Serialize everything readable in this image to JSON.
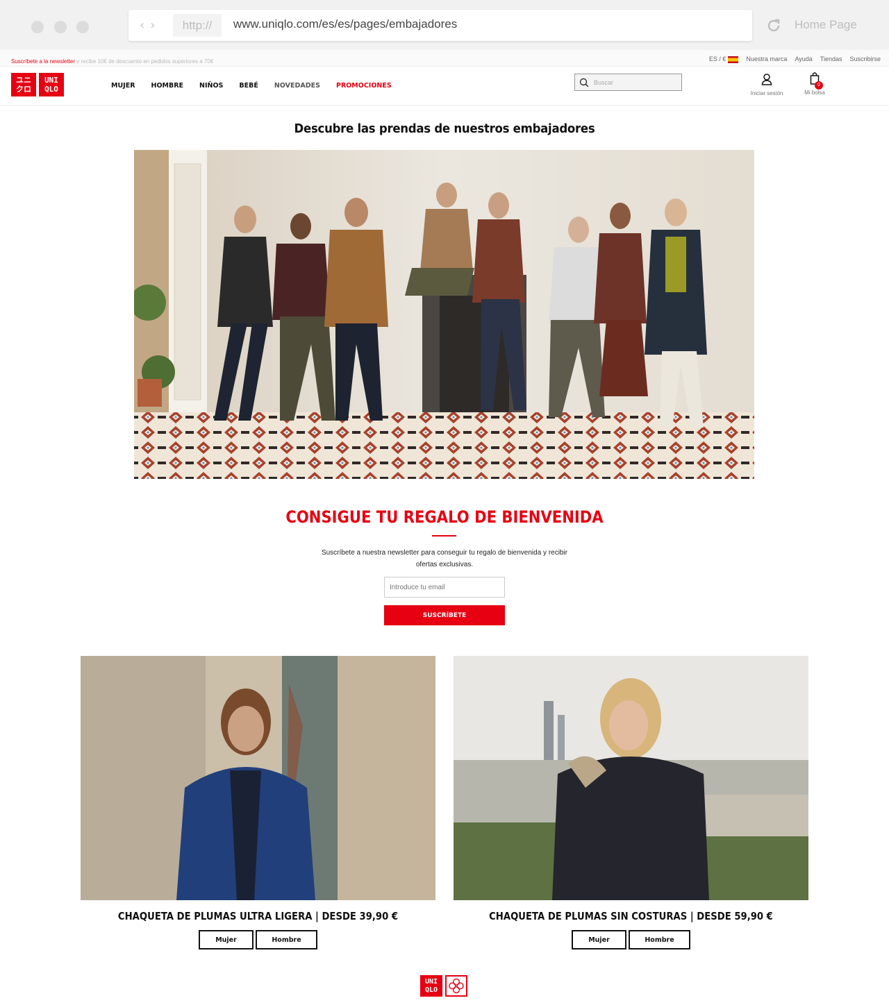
{
  "browser": {
    "protocol": "http://",
    "url": "www.uniqlo.com/es/es/pages/embajadores",
    "home_label": "Home Page"
  },
  "utility": {
    "promo_red": "Suscríbete a la newsletter",
    "promo_grey": " y recibe 10€ de descuento en pedidos superiores a 70€",
    "locale": "ES / €",
    "links": [
      "Nuestra marca",
      "Ayuda",
      "Tiendas",
      "Suscribirse"
    ]
  },
  "header": {
    "logo_top_left": "ユニ",
    "logo_bottom_left": "クロ",
    "logo_top_right": "UNI",
    "logo_bottom_right": "QLO",
    "nav": [
      "MUJER",
      "HOMBRE",
      "NIÑOS",
      "BEBÉ",
      "NOVEDADES",
      "PROMOCIONES"
    ],
    "search_placeholder": "Buscar",
    "account_label": "Iniciar sesión",
    "bag_label": "Mi bolsa",
    "bag_count": "0"
  },
  "hero": {
    "title": "Descubre las prendas de nuestros embajadores"
  },
  "newsletter": {
    "title": "CONSIGUE TU REGALO DE BIENVENIDA",
    "text": "Suscríbete a nuestra newsletter para conseguir tu regalo de bienvenida y recibir ofertas exclusivas.",
    "email_placeholder": "Introduce tu email",
    "button": "SUSCRÍBETE"
  },
  "products": [
    {
      "title": "CHAQUETA DE PLUMAS ULTRA LIGERA | DESDE 39,90 €",
      "btn_women": "Mujer",
      "btn_men": "Hombre"
    },
    {
      "title": "CHAQUETA DE PLUMAS SIN COSTURAS | DESDE 59,90 €",
      "btn_women": "Mujer",
      "btn_men": "Hombre"
    }
  ],
  "footer": {
    "logo_top": "UNI",
    "logo_bottom": "QLO"
  },
  "colors": {
    "brand_red": "#e60012",
    "text": "#111111",
    "chrome_bg": "#f1f1f1"
  },
  "icons": [
    "chevron-left-icon",
    "chevron-right-icon",
    "reload-icon",
    "spain-flag-icon",
    "search-icon",
    "user-icon",
    "shopping-bag-icon"
  ]
}
